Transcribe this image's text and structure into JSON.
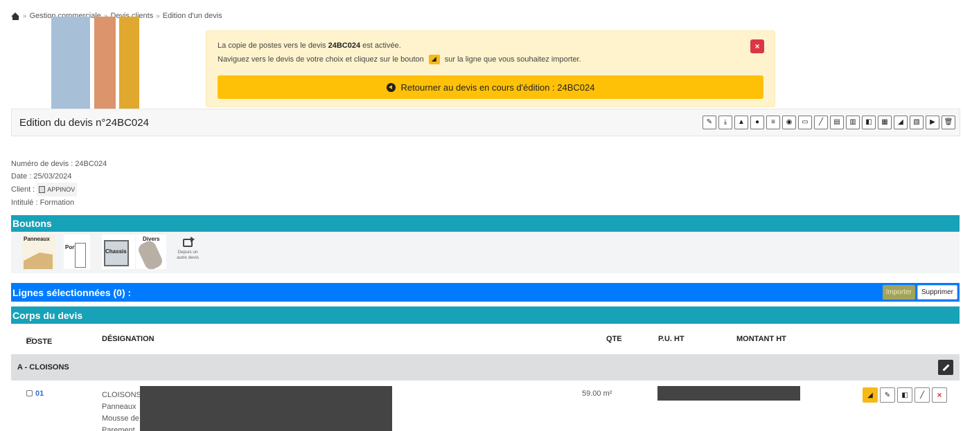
{
  "breadcrumb": {
    "items": [
      "Gestion commerciale",
      "Devis clients",
      "Edition d'un devis"
    ],
    "separator": "»"
  },
  "alert": {
    "line1_pre": "La copie de postes vers le devis ",
    "line1_bold": "24BC024",
    "line1_post": " est activée.",
    "line2_pre": "Naviguez vers le devis de votre choix et cliquez sur le bouton",
    "line2_post": "sur la ligne que vous souhaitez importer.",
    "close_label": "×",
    "back_button": "Retourner au devis en cours d'édition : 24BC024"
  },
  "edition": {
    "title": "Edition du devis n°24BC024",
    "toolbar": [
      "✎",
      "⤓",
      "▲",
      "●",
      "≡",
      "◉",
      "▭",
      "╱",
      "▤",
      "▥",
      "◧",
      "▦",
      "◢",
      "▧",
      "▶",
      "🗑"
    ]
  },
  "info": {
    "numero": "Numéro de devis : 24BC024",
    "date": "Date : 25/03/2024",
    "client_label": "Client :",
    "client_name": "APPINOV",
    "intitule": "Intitulé : Formation"
  },
  "sections": {
    "boutons": "Boutons",
    "lignes": "Lignes sélectionnées (0) :",
    "corps": "Corps du devis"
  },
  "tiles": {
    "panneaux": "Panneaux",
    "portes": "Portes",
    "chassis": "Chassis",
    "divers": "Divers",
    "depuis_1": "Depuis un",
    "depuis_2": "autre devis"
  },
  "actions": {
    "importer": "Importer",
    "supprimer": "Supprimer"
  },
  "table": {
    "headers": {
      "poste": "POSTE",
      "designation": "DÉSIGNATION",
      "qte": "QTE",
      "pu": "P.U. HT",
      "montant": "MONTANT HT"
    },
    "group": "A - CLOISONS",
    "rows": [
      {
        "poste": "01",
        "designation": [
          "CLOISONS",
          "Panneaux",
          "Mousse de",
          "Parement"
        ],
        "qte": "59.00 m²"
      }
    ],
    "row_actions": [
      "◢",
      "✎",
      "◧",
      "╱",
      "×"
    ]
  },
  "colors": {
    "teal": "#17a2b8",
    "blue": "#007bff",
    "warning": "#ffc107",
    "danger": "#dc3545"
  }
}
